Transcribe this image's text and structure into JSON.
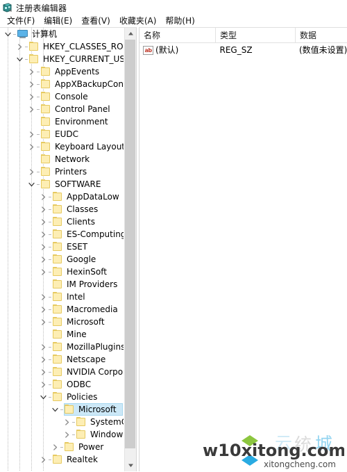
{
  "window": {
    "title": "注册表编辑器",
    "icon": "registry-editor-icon"
  },
  "menubar": {
    "items": [
      {
        "label": "文件(F)",
        "name": "menu-file"
      },
      {
        "label": "编辑(E)",
        "name": "menu-edit"
      },
      {
        "label": "查看(V)",
        "name": "menu-view"
      },
      {
        "label": "收藏夹(A)",
        "name": "menu-favorites"
      },
      {
        "label": "帮助(H)",
        "name": "menu-help"
      }
    ]
  },
  "tree": {
    "nodes": [
      {
        "label": "计算机",
        "level": 0,
        "icon": "computer-icon",
        "expanded": true,
        "hasChildren": true,
        "selected": false
      },
      {
        "label": "HKEY_CLASSES_ROOT",
        "level": 1,
        "icon": "folder-icon",
        "expanded": false,
        "hasChildren": true,
        "selected": false
      },
      {
        "label": "HKEY_CURRENT_USER",
        "level": 1,
        "icon": "folder-icon",
        "expanded": true,
        "hasChildren": true,
        "selected": false
      },
      {
        "label": "AppEvents",
        "level": 2,
        "icon": "folder-icon",
        "expanded": false,
        "hasChildren": true,
        "selected": false
      },
      {
        "label": "AppXBackupConter",
        "level": 2,
        "icon": "folder-icon",
        "expanded": false,
        "hasChildren": true,
        "selected": false
      },
      {
        "label": "Console",
        "level": 2,
        "icon": "folder-icon",
        "expanded": false,
        "hasChildren": true,
        "selected": false
      },
      {
        "label": "Control Panel",
        "level": 2,
        "icon": "folder-icon",
        "expanded": false,
        "hasChildren": true,
        "selected": false
      },
      {
        "label": "Environment",
        "level": 2,
        "icon": "folder-icon",
        "expanded": false,
        "hasChildren": false,
        "selected": false
      },
      {
        "label": "EUDC",
        "level": 2,
        "icon": "folder-icon",
        "expanded": false,
        "hasChildren": true,
        "selected": false
      },
      {
        "label": "Keyboard Layout",
        "level": 2,
        "icon": "folder-icon",
        "expanded": false,
        "hasChildren": true,
        "selected": false
      },
      {
        "label": "Network",
        "level": 2,
        "icon": "folder-icon",
        "expanded": false,
        "hasChildren": false,
        "selected": false
      },
      {
        "label": "Printers",
        "level": 2,
        "icon": "folder-icon",
        "expanded": false,
        "hasChildren": true,
        "selected": false
      },
      {
        "label": "SOFTWARE",
        "level": 2,
        "icon": "folder-icon",
        "expanded": true,
        "hasChildren": true,
        "selected": false
      },
      {
        "label": "AppDataLow",
        "level": 3,
        "icon": "folder-icon",
        "expanded": false,
        "hasChildren": true,
        "selected": false
      },
      {
        "label": "Classes",
        "level": 3,
        "icon": "folder-icon",
        "expanded": false,
        "hasChildren": true,
        "selected": false
      },
      {
        "label": "Clients",
        "level": 3,
        "icon": "folder-icon",
        "expanded": false,
        "hasChildren": true,
        "selected": false
      },
      {
        "label": "ES-Computing",
        "level": 3,
        "icon": "folder-icon",
        "expanded": false,
        "hasChildren": true,
        "selected": false
      },
      {
        "label": "ESET",
        "level": 3,
        "icon": "folder-icon",
        "expanded": false,
        "hasChildren": true,
        "selected": false
      },
      {
        "label": "Google",
        "level": 3,
        "icon": "folder-icon",
        "expanded": false,
        "hasChildren": true,
        "selected": false
      },
      {
        "label": "HexinSoft",
        "level": 3,
        "icon": "folder-icon",
        "expanded": false,
        "hasChildren": true,
        "selected": false
      },
      {
        "label": "IM Providers",
        "level": 3,
        "icon": "folder-icon",
        "expanded": false,
        "hasChildren": false,
        "selected": false
      },
      {
        "label": "Intel",
        "level": 3,
        "icon": "folder-icon",
        "expanded": false,
        "hasChildren": true,
        "selected": false
      },
      {
        "label": "Macromedia",
        "level": 3,
        "icon": "folder-icon",
        "expanded": false,
        "hasChildren": true,
        "selected": false
      },
      {
        "label": "Microsoft",
        "level": 3,
        "icon": "folder-icon",
        "expanded": false,
        "hasChildren": true,
        "selected": false
      },
      {
        "label": "Mine",
        "level": 3,
        "icon": "folder-icon",
        "expanded": false,
        "hasChildren": false,
        "selected": false
      },
      {
        "label": "MozillaPlugins",
        "level": 3,
        "icon": "folder-icon",
        "expanded": false,
        "hasChildren": true,
        "selected": false
      },
      {
        "label": "Netscape",
        "level": 3,
        "icon": "folder-icon",
        "expanded": false,
        "hasChildren": true,
        "selected": false
      },
      {
        "label": "NVIDIA Corpora",
        "level": 3,
        "icon": "folder-icon",
        "expanded": false,
        "hasChildren": true,
        "selected": false
      },
      {
        "label": "ODBC",
        "level": 3,
        "icon": "folder-icon",
        "expanded": false,
        "hasChildren": true,
        "selected": false
      },
      {
        "label": "Policies",
        "level": 3,
        "icon": "folder-icon",
        "expanded": true,
        "hasChildren": true,
        "selected": false
      },
      {
        "label": "Microsoft",
        "level": 4,
        "icon": "folder-icon",
        "expanded": true,
        "hasChildren": true,
        "selected": true
      },
      {
        "label": "SystemCe",
        "level": 5,
        "icon": "folder-icon",
        "expanded": false,
        "hasChildren": true,
        "selected": false
      },
      {
        "label": "Windows",
        "level": 5,
        "icon": "folder-icon",
        "expanded": false,
        "hasChildren": true,
        "selected": false
      },
      {
        "label": "Power",
        "level": 4,
        "icon": "folder-icon",
        "expanded": false,
        "hasChildren": true,
        "selected": false
      },
      {
        "label": "Realtek",
        "level": 3,
        "icon": "folder-icon",
        "expanded": false,
        "hasChildren": true,
        "selected": false
      }
    ],
    "scrollbar": {
      "up_arrow": "scroll-up-arrow",
      "down_arrow": "scroll-down-arrow"
    }
  },
  "list": {
    "columns": [
      {
        "label": "名称",
        "name": "column-name"
      },
      {
        "label": "类型",
        "name": "column-type"
      },
      {
        "label": "数据",
        "name": "column-data"
      }
    ],
    "rows": [
      {
        "icon": "string-value-icon",
        "icon_text": "ab",
        "name": "(默认)",
        "type": "REG_SZ",
        "data": "(数值未设置)"
      }
    ]
  },
  "watermark": {
    "primary": "w10xitong.com",
    "secondary": "xitongcheng.com",
    "ghost": "云 统 城"
  },
  "colors": {
    "selection": "#cce8f7",
    "folder": "#fdeeb4",
    "folder_border": "#e6c95f",
    "scrollbar_thumb": "#cdcdcd",
    "watermark_green": "#8cc63f",
    "watermark_blue": "#29abe2"
  }
}
